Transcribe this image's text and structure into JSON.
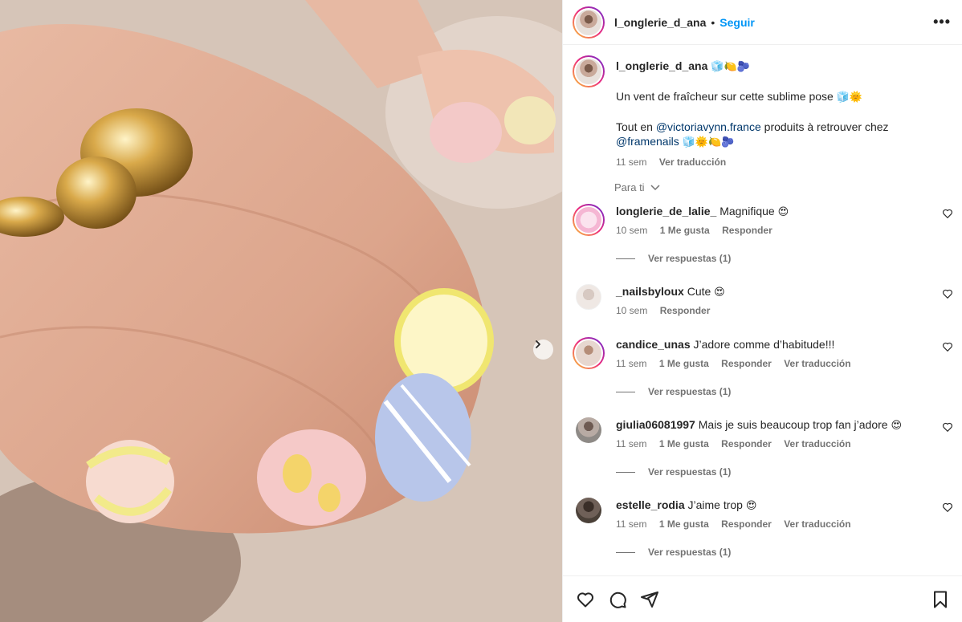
{
  "post": {
    "username": "l_onglerie_d_ana",
    "follow_label": "Seguir",
    "more_label": "•••",
    "next_label": "›"
  },
  "caption": {
    "username": "l_onglerie_d_ana",
    "username_emoji": "🧊🍋🫐",
    "line1": "Un vent de fraîcheur sur cette sublime pose",
    "line1_emoji": "🧊🌞",
    "line2_prefix": "Tout en",
    "mention1": "@victoriavynn.france",
    "line2_suffix": "produits à retrouver chez",
    "mention2": "@framenails",
    "line3_emoji": "🧊🌞🍋🫐",
    "time": "11 sem",
    "translate": "Ver traducción"
  },
  "filter": {
    "label": "Para ti"
  },
  "comments": [
    {
      "user": "longlerie_de_lalie_",
      "text": "Magnifique",
      "emoji": "😍",
      "time": "10 sem",
      "likes": "1 Me gusta",
      "reply": "Responder",
      "translate": "",
      "replies": "Ver respuestas (1)"
    },
    {
      "user": "_nailsbyloux",
      "text": "Cute",
      "emoji": "😍",
      "time": "10 sem",
      "likes": "",
      "reply": "Responder",
      "translate": "",
      "replies": ""
    },
    {
      "user": "candice_unas",
      "text": "J’adore comme d’habitude!!!",
      "emoji": "",
      "time": "11 sem",
      "likes": "1 Me gusta",
      "reply": "Responder",
      "translate": "Ver traducción",
      "replies": "Ver respuestas (1)"
    },
    {
      "user": "giulia06081997",
      "text": "Mais je suis beaucoup trop fan j’adore",
      "emoji": "😍",
      "time": "11 sem",
      "likes": "1 Me gusta",
      "reply": "Responder",
      "translate": "Ver traducción",
      "replies": "Ver respuestas (1)"
    },
    {
      "user": "estelle_rodia",
      "text": "J’aime trop",
      "emoji": "😍",
      "time": "11 sem",
      "likes": "1 Me gusta",
      "reply": "Responder",
      "translate": "Ver traducción",
      "replies": "Ver respuestas (1)"
    }
  ],
  "icons": {
    "like": "heart-icon",
    "comment": "comment-icon",
    "share": "share-icon",
    "save": "bookmark-icon"
  },
  "colors": {
    "accent": "#0095f6",
    "mention": "#00376b",
    "muted": "#737373"
  }
}
